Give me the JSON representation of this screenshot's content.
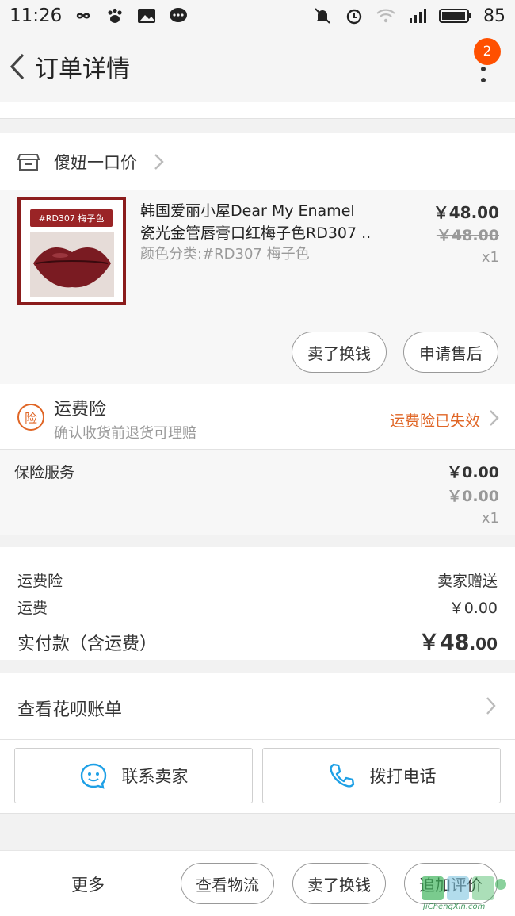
{
  "statusbar": {
    "time": "11:26",
    "battery": "85"
  },
  "nav": {
    "title": "订单详情",
    "badge": "2"
  },
  "store": {
    "name": "傻妞一口价"
  },
  "product": {
    "thumb_tag": "#RD307 梅子色",
    "title_line1": "韩国爱丽小屋Dear My Enamel",
    "title_line2": "瓷光金管唇膏口红梅子色RD307 ..",
    "sku": "颜色分类:#RD307 梅子色",
    "price": "￥48.00",
    "orig_price": "￥48.00",
    "qty": "x1",
    "btn_sell": "卖了换钱",
    "btn_aftersale": "申请售后"
  },
  "insurance": {
    "icon_char": "险",
    "title": "运费险",
    "subtitle": "确认收货前退货可理赔",
    "status": "运费险已失效"
  },
  "service": {
    "label": "保险服务",
    "price": "￥0.00",
    "orig_price": "￥0.00",
    "qty": "x1"
  },
  "summary": {
    "rows": [
      {
        "label": "运费险",
        "value": "卖家赠送"
      },
      {
        "label": "运费",
        "value": "￥0.00"
      }
    ],
    "total_label": "实付款（含运费）",
    "total_int": "￥48",
    "total_dec": ".00"
  },
  "huabei": {
    "label": "查看花呗账单"
  },
  "contact": {
    "seller": "联系卖家",
    "phone": "拨打电话"
  },
  "bottombar": {
    "more": "更多",
    "buttons": [
      "查看物流",
      "卖了换钱",
      "追加评价"
    ]
  },
  "watermark": {
    "text": "JiChengXin.com"
  },
  "colors": {
    "accent": "#ff5000",
    "insurance": "#e06626",
    "icon_blue": "#1ea0e6"
  }
}
